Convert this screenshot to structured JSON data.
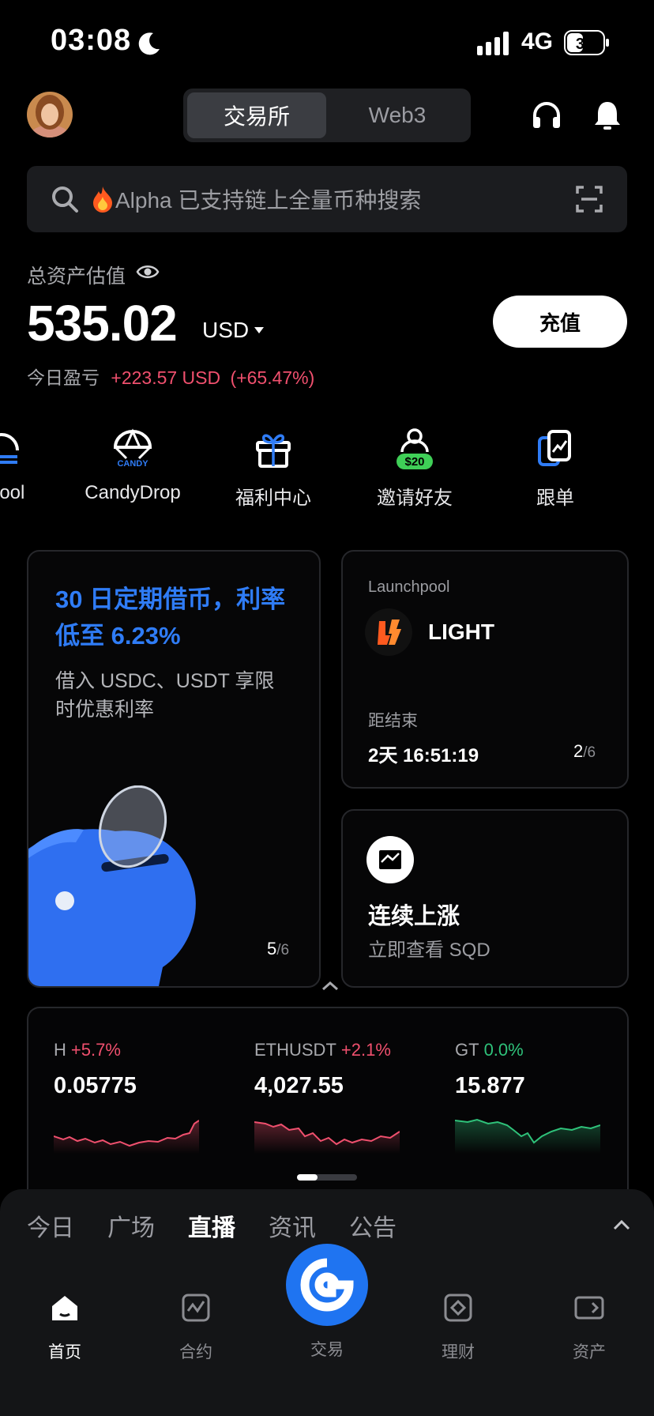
{
  "status_bar": {
    "time": "03:08",
    "network": "4G",
    "battery": "36"
  },
  "header": {
    "tabs": [
      {
        "label": "交易所"
      },
      {
        "label": "Web3"
      }
    ]
  },
  "search": {
    "placeholder": "Alpha 已支持链上全量币种搜索"
  },
  "balance": {
    "label": "总资产估值",
    "amount": "535.02",
    "currency": "USD",
    "deposit_label": "充值",
    "pnl_label": "今日盈亏",
    "pnl_value": "+223.57 USD",
    "pnl_pct": "(+65.47%)"
  },
  "quick_actions": [
    {
      "label": "npool"
    },
    {
      "label": "CandyDrop",
      "icon_text": "CANDY"
    },
    {
      "label": "福利中心"
    },
    {
      "label": "邀请好友",
      "icon_text": "$20"
    },
    {
      "label": "跟单"
    }
  ],
  "promo_card": {
    "title": "30 日定期借币，利率低至 6.23%",
    "subtitle": "借入 USDC、USDT 享限时优惠利率",
    "page": "5",
    "total": "/6"
  },
  "launchpool_card": {
    "label": "Launchpool",
    "token": "LIGHT",
    "ends_label": "距结束",
    "countdown": "2天 16:51:19",
    "page": "2",
    "total": "/6"
  },
  "rise_card": {
    "title": "连续上涨",
    "subtitle": "立即查看 SQD"
  },
  "tickers": [
    {
      "symbol": "H",
      "change": "+5.7%",
      "price": "0.05775",
      "trend": "up"
    },
    {
      "symbol": "ETHUSDT",
      "change": "+2.1%",
      "price": "4,027.55",
      "trend": "up"
    },
    {
      "symbol": "GT",
      "change": "0.0%",
      "price": "15.877",
      "trend": "flat"
    }
  ],
  "feed_tabs": [
    {
      "label": "今日"
    },
    {
      "label": "广场"
    },
    {
      "label": "直播"
    },
    {
      "label": "资讯"
    },
    {
      "label": "公告"
    }
  ],
  "nav": [
    {
      "label": "首页"
    },
    {
      "label": "合约"
    },
    {
      "label": "交易"
    },
    {
      "label": "理财"
    },
    {
      "label": "资产"
    }
  ],
  "colors": {
    "accent": "#1f74f1",
    "up": "#f0506e",
    "flat": "#2fc27a",
    "promo_title": "#2f7cf6"
  }
}
